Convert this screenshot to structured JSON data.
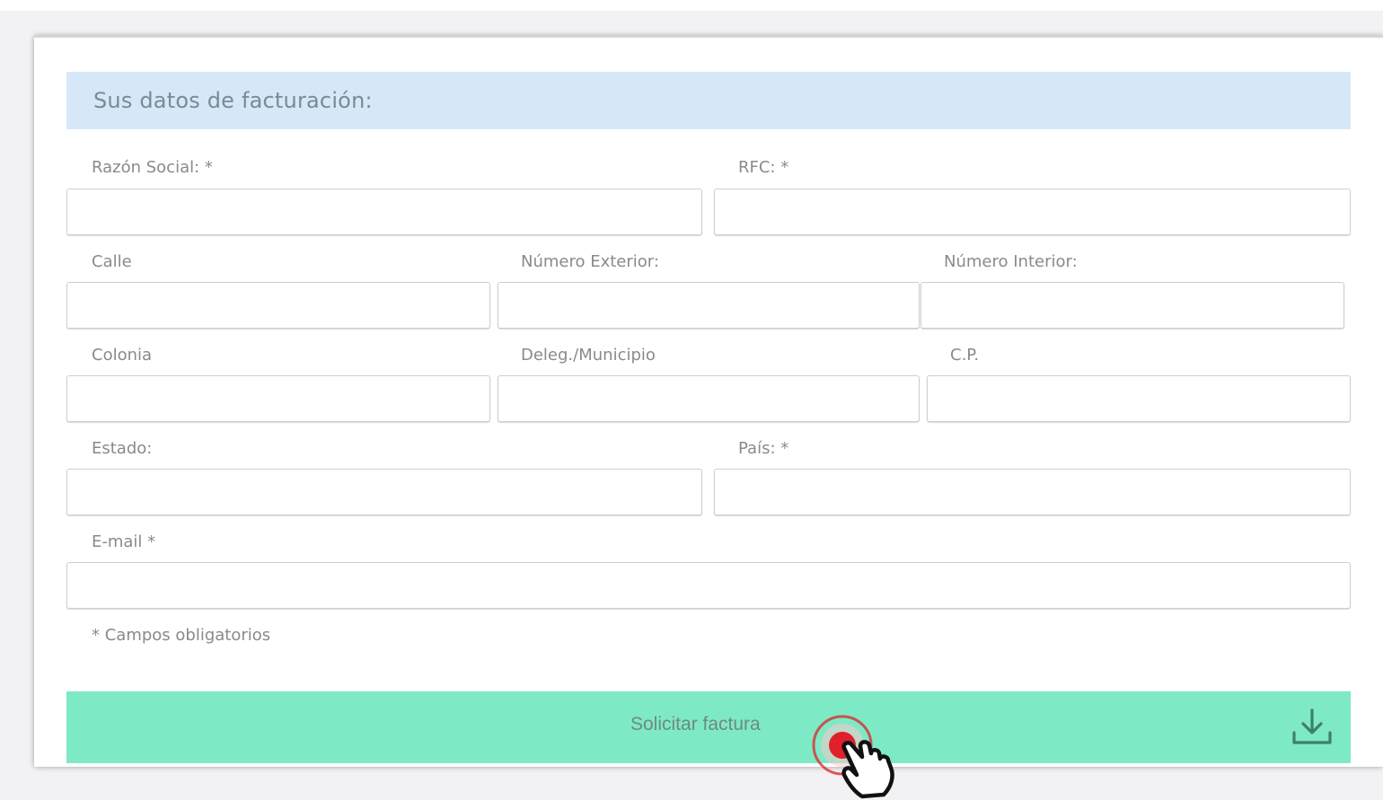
{
  "form": {
    "section_title": "Sus datos de facturación:",
    "fields": {
      "razon_social": {
        "label": "Razón Social: *",
        "value": ""
      },
      "rfc": {
        "label": "RFC: *",
        "value": ""
      },
      "calle": {
        "label": "Calle",
        "value": ""
      },
      "numero_exterior": {
        "label": "Número Exterior:",
        "value": ""
      },
      "numero_interior": {
        "label": "Número Interior:",
        "value": ""
      },
      "colonia": {
        "label": "Colonia",
        "value": ""
      },
      "delegacion_municipio": {
        "label": "Deleg./Municipio",
        "value": ""
      },
      "cp": {
        "label": "C.P.",
        "value": ""
      },
      "estado": {
        "label": "Estado:",
        "value": ""
      },
      "pais": {
        "label": "País: *",
        "value": ""
      },
      "email": {
        "label": "E-mail *",
        "value": ""
      }
    },
    "required_note": "* Campos obligatorios",
    "submit_label": "Solicitar factura",
    "submit_icon": "download-icon",
    "cursor_icon": "hand-pointer-icon"
  },
  "colors": {
    "header_bg": "#d6e8f8",
    "submit_bg": "#7eeac5",
    "click_marker": "#e0202a"
  }
}
